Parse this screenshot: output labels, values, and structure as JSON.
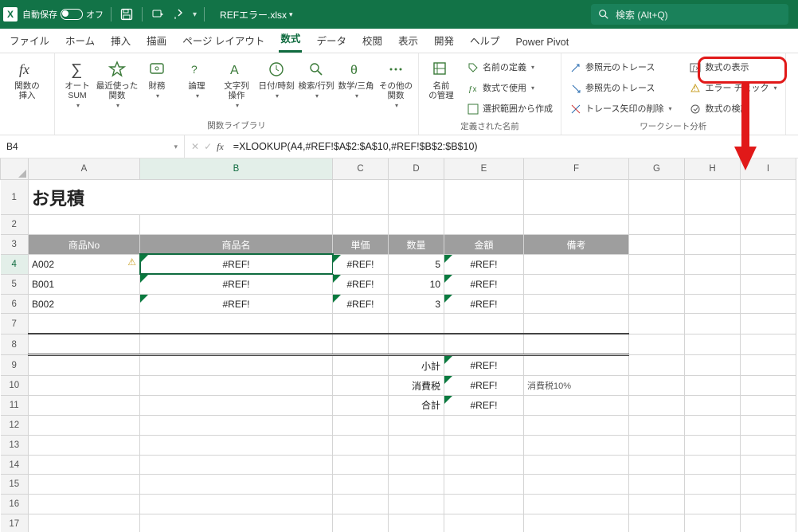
{
  "titlebar": {
    "app_icon": "X",
    "autosave_label": "自動保存",
    "autosave_state": "オフ",
    "filename": "REFエラー.xlsx"
  },
  "search": {
    "placeholder": "検索 (Alt+Q)"
  },
  "tabs": {
    "file": "ファイル",
    "home": "ホーム",
    "insert": "挿入",
    "draw": "描画",
    "layout": "ページ レイアウト",
    "formulas": "数式",
    "data": "データ",
    "review": "校閲",
    "view": "表示",
    "dev": "開発",
    "help": "ヘルプ",
    "pivot": "Power Pivot"
  },
  "ribbon": {
    "fx": "関数の\n挿入",
    "autosum": "オート\nSUM",
    "recent": "最近使った\n関数",
    "fin": "財務",
    "log": "論理",
    "text": "文字列\n操作",
    "date": "日付/時刻",
    "lookup": "検索/行列",
    "math": "数学/三角",
    "more": "その他の\n関数",
    "grp_lib": "関数ライブラリ",
    "nm_mgr": "名前\nの管理",
    "nm_def": "名前の定義",
    "nm_use": "数式で使用",
    "nm_sel": "選択範囲から作成",
    "grp_nm": "定義された名前",
    "tr_prec": "参照元のトレース",
    "tr_dep": "参照先のトレース",
    "tr_rem": "トレース矢印の削除",
    "show_f": "数式の表示",
    "err_chk": "エラー チェック",
    "eval": "数式の検証",
    "grp_aud": "ワークシート分析"
  },
  "namebox": "B4",
  "formula": "=XLOOKUP(A4,#REF!$A$2:$A$10,#REF!$B$2:$B$10)",
  "cols": [
    "A",
    "B",
    "C",
    "D",
    "E",
    "F",
    "G",
    "H",
    "I"
  ],
  "sheet": {
    "a1": "お見積",
    "hdr": {
      "a": "商品No",
      "b": "商品名",
      "c": "単価",
      "d": "数量",
      "e": "金額",
      "f": "備考"
    },
    "rows": [
      {
        "a": "A002",
        "b": "#REF!",
        "c": "#REF!",
        "d": "5",
        "e": "#REF!"
      },
      {
        "a": "B001",
        "b": "#REF!",
        "c": "#REF!",
        "d": "10",
        "e": "#REF!"
      },
      {
        "a": "B002",
        "b": "#REF!",
        "c": "#REF!",
        "d": "3",
        "e": "#REF!"
      }
    ],
    "subtotal_l": "小計",
    "subtotal_v": "#REF!",
    "tax_l": "消費税",
    "tax_v": "#REF!",
    "tax_note": "消費税10%",
    "total_l": "合計",
    "total_v": "#REF!"
  }
}
